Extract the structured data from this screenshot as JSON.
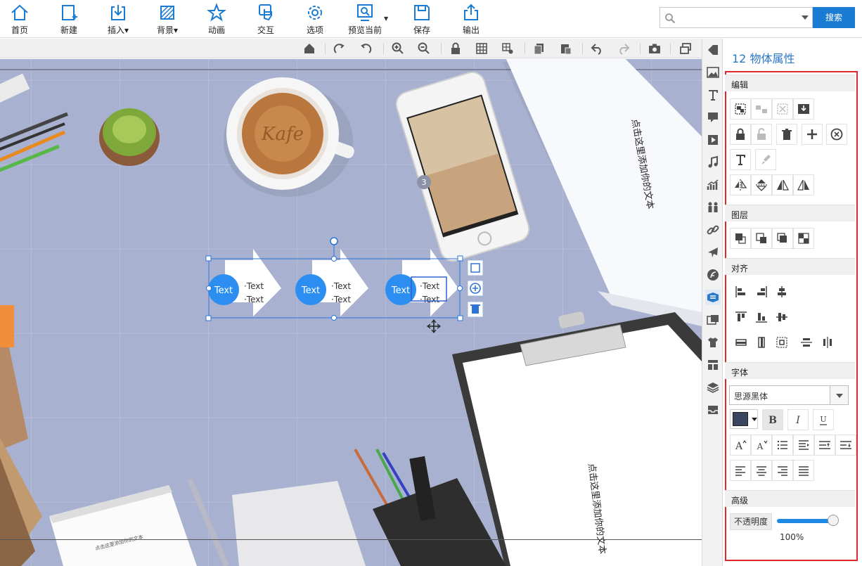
{
  "toolbar": {
    "home": "首页",
    "new": "新建",
    "insert": "插入",
    "background": "背景",
    "animation": "动画",
    "interaction": "交互",
    "options": "选项",
    "preview": "预览当前",
    "save": "保存",
    "export": "输出"
  },
  "search": {
    "placeholder": "",
    "button": "搜索"
  },
  "canvas": {
    "diagram_circle_label": "Text",
    "bullet_1": "·Text",
    "bullet_2": "·Text",
    "page_badge": "3",
    "card_text_1": "点击这里添加你的文本",
    "card_text_2": "点击这里添加你的文本",
    "notebook_text": "点击这里添加你的文本",
    "cup_text": "Kafe"
  },
  "panel": {
    "title": "12 物体属性",
    "sections": {
      "edit": "编辑",
      "layer": "图层",
      "align": "对齐",
      "font": "字体",
      "advanced": "高级"
    },
    "font_name": "思源黑体",
    "opacity_label": "不透明度",
    "opacity_value": "100%",
    "opacity_fraction": 1.0
  },
  "colors": {
    "accent": "#1a7bd2",
    "canvas_bg": "#a8b2d0",
    "highlight_border": "#e0282c",
    "diagram_circle": "#2b8ef0",
    "panel_title": "#2a78c8"
  }
}
